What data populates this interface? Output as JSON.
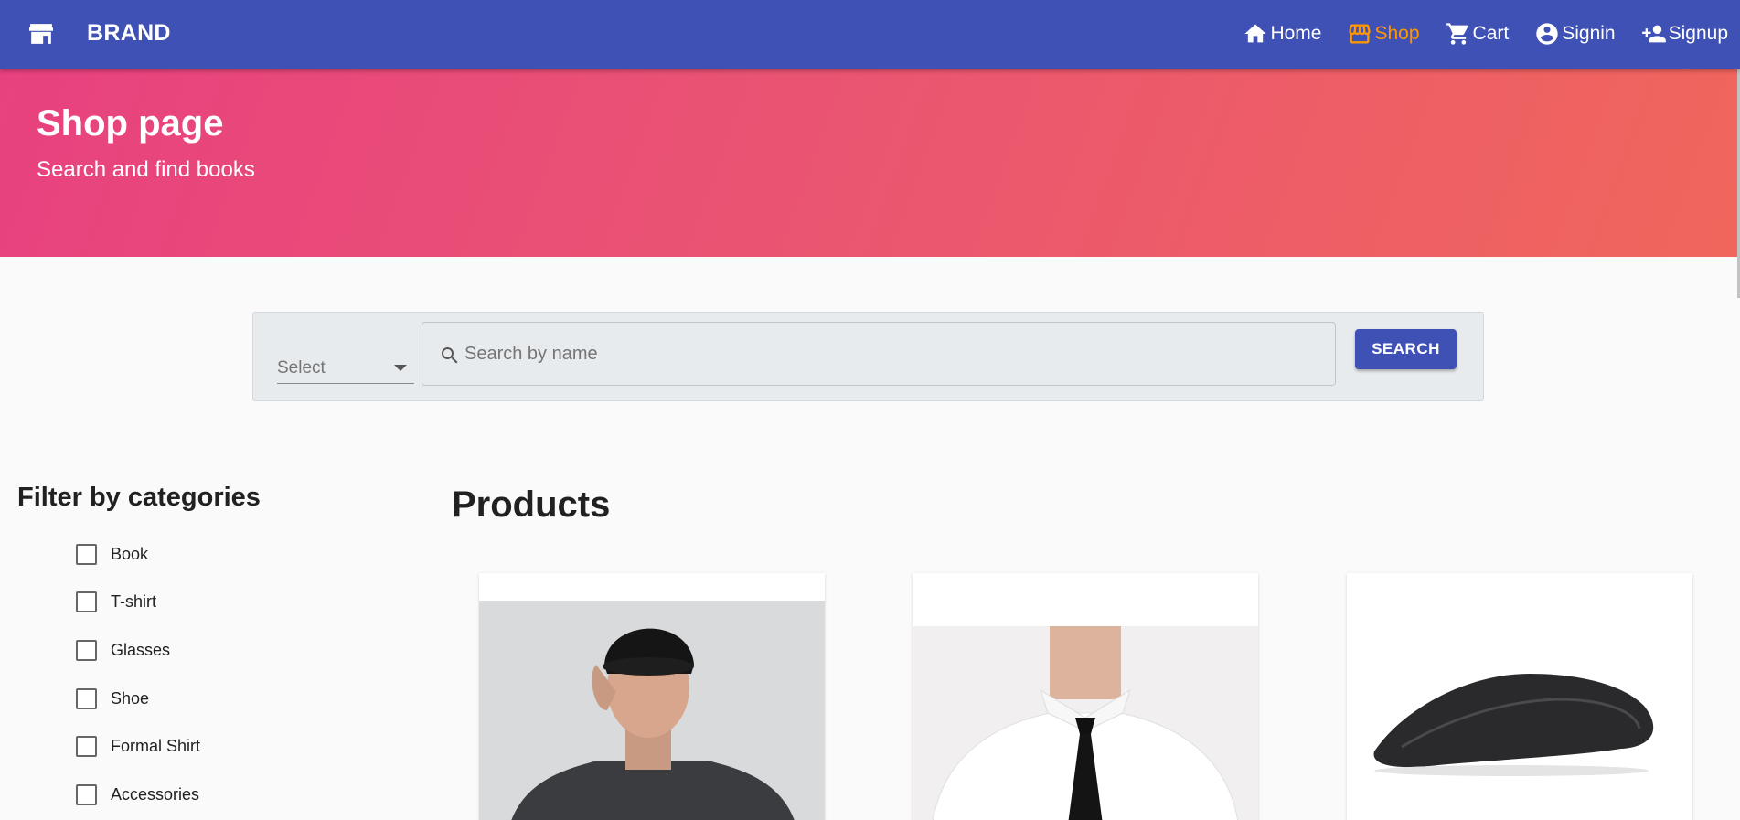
{
  "brand": {
    "name": "BRAND",
    "icon": "store-icon"
  },
  "nav": [
    {
      "label": "Home",
      "icon": "home-icon",
      "active": false
    },
    {
      "label": "Shop",
      "icon": "storefront-icon",
      "active": true
    },
    {
      "label": "Cart",
      "icon": "cart-icon",
      "active": false
    },
    {
      "label": "Signin",
      "icon": "account-circle-icon",
      "active": false
    },
    {
      "label": "Signup",
      "icon": "person-add-icon",
      "active": false
    }
  ],
  "hero": {
    "title": "Shop page",
    "subtitle": "Search and find books"
  },
  "search": {
    "select_label": "Select",
    "placeholder": "Search by name",
    "value": "",
    "button_label": "SEARCH"
  },
  "filter": {
    "title": "Filter by categories",
    "categories": [
      {
        "label": "Book",
        "checked": false
      },
      {
        "label": "T-shirt",
        "checked": false
      },
      {
        "label": "Glasses",
        "checked": false
      },
      {
        "label": "Shoe",
        "checked": false
      },
      {
        "label": "Formal Shirt",
        "checked": false
      },
      {
        "label": "Accessories",
        "checked": false
      }
    ]
  },
  "products": {
    "title": "Products",
    "items": [
      {
        "image": "man-in-cap-image"
      },
      {
        "image": "shirt-and-tie-image"
      },
      {
        "image": "wireless-mouse-image"
      }
    ]
  },
  "colors": {
    "primary": "#3f51b5",
    "active_nav": "#ff9800",
    "hero_start": "#e8417f",
    "hero_end": "#f0665c"
  }
}
